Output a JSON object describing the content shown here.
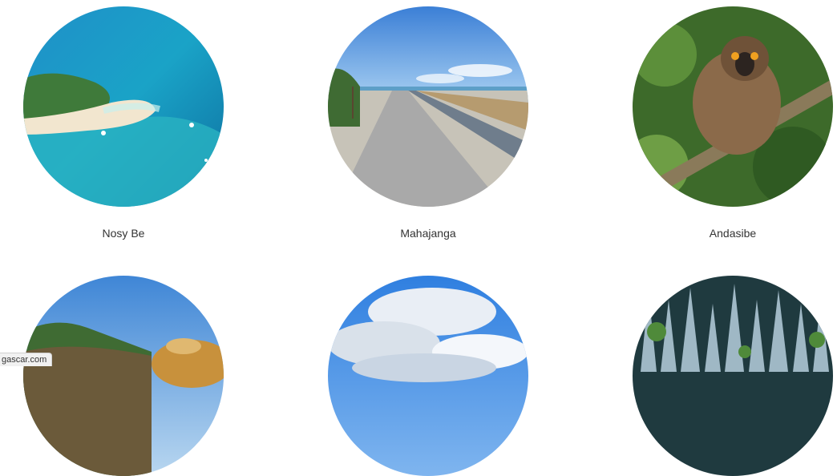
{
  "destinations": [
    {
      "name": "Nosy Be",
      "image": "tropical-island-beach-photo"
    },
    {
      "name": "Mahajanga",
      "image": "seaside-promenade-photo"
    },
    {
      "name": "Andasibe",
      "image": "lemur-on-branch-photo"
    },
    {
      "name": "",
      "image": "hills-and-forest-photo"
    },
    {
      "name": "",
      "image": "cloudy-sky-photo"
    },
    {
      "name": "",
      "image": "stone-forest-tsingy-photo"
    }
  ],
  "status_bar": {
    "url_text": "gascar.com"
  }
}
